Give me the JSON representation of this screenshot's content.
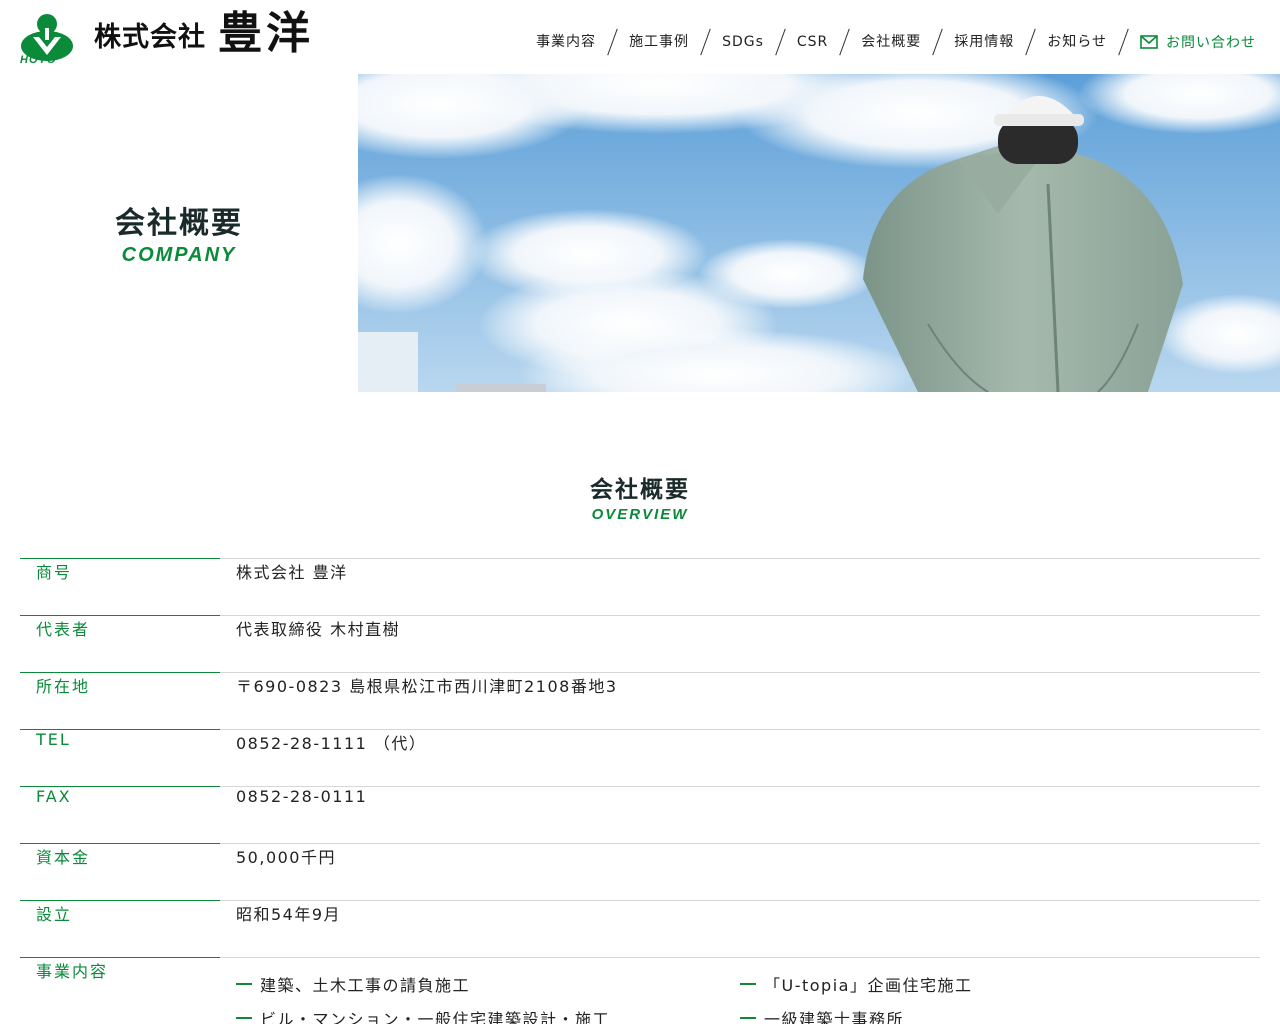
{
  "header": {
    "logo_text": "HOYO",
    "company_prefix": "株式会社",
    "company_name": "豊洋",
    "nav": [
      {
        "label": "事業内容"
      },
      {
        "label": "施工事例"
      },
      {
        "label": "SDGs"
      },
      {
        "label": "CSR"
      },
      {
        "label": "会社概要"
      },
      {
        "label": "採用情報"
      },
      {
        "label": "お知らせ"
      }
    ],
    "contact_label": "お問い合わせ"
  },
  "hero": {
    "title": "会社概要",
    "subtitle": "COMPANY"
  },
  "overview": {
    "title": "会社概要",
    "subtitle": "OVERVIEW",
    "rows": [
      {
        "label": "商号",
        "value": "株式会社 豊洋"
      },
      {
        "label": "代表者",
        "value": "代表取締役 木村直樹"
      },
      {
        "label": "所在地",
        "value": "〒690-0823 島根県松江市西川津町2108番地3"
      },
      {
        "label": "TEL",
        "value": "0852-28-1111 （代）"
      },
      {
        "label": "FAX",
        "value": "0852-28-0111"
      },
      {
        "label": "資本金",
        "value": "50,000千円"
      },
      {
        "label": "設立",
        "value": "昭和54年9月"
      }
    ],
    "business_label": "事業内容",
    "business_items": [
      "建築、土木工事の請負施工",
      "「U-topia」企画住宅施工",
      "ビル・マンション・一般住宅建築設計・施工",
      "一級建築士事務所"
    ]
  },
  "colors": {
    "brand_green": "#0b8a3a"
  }
}
